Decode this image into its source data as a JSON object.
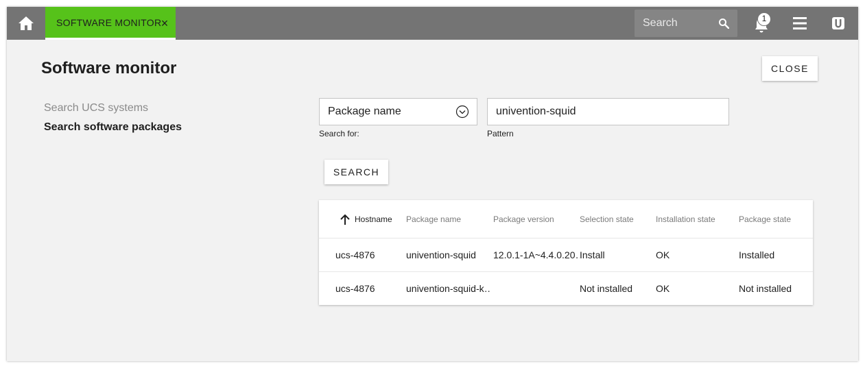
{
  "topbar": {
    "tab_label": "SOFTWARE MONITOR",
    "tab_close": "×",
    "search_placeholder": "Search",
    "notification_count": "1"
  },
  "page": {
    "title": "Software monitor",
    "close_label": "CLOSE"
  },
  "sidebar": {
    "items": [
      {
        "label": "Search UCS systems",
        "active": false
      },
      {
        "label": "Search software packages",
        "active": true
      }
    ]
  },
  "form": {
    "search_for": {
      "value": "Package name",
      "label": "Search for:"
    },
    "pattern": {
      "value": "univention-squid",
      "label": "Pattern"
    },
    "search_label": "SEARCH"
  },
  "grid": {
    "columns": [
      "Hostname",
      "Package name",
      "Package version",
      "Selection state",
      "Installation state",
      "Package state"
    ],
    "sort_column": "Hostname",
    "sort_direction": "ascending",
    "rows": [
      [
        "ucs-4876",
        "univention-squid",
        "12.0.1-1A~4.4.0.20…",
        "Install",
        "OK",
        "Installed"
      ],
      [
        "ucs-4876",
        "univention-squid-k…",
        "",
        "Not installed",
        "OK",
        "Not installed"
      ]
    ]
  },
  "colors": {
    "topbar": "#747474",
    "active_tab": "#56c21a",
    "background": "#f2f2f2"
  }
}
